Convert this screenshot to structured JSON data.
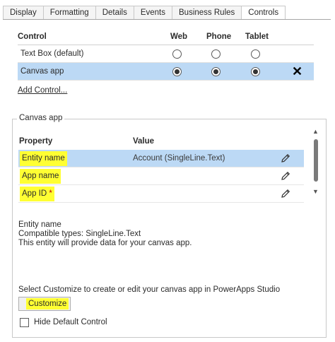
{
  "tabs": [
    {
      "label": "Display"
    },
    {
      "label": "Formatting"
    },
    {
      "label": "Details"
    },
    {
      "label": "Events"
    },
    {
      "label": "Business Rules"
    },
    {
      "label": "Controls"
    }
  ],
  "active_tab": "Controls",
  "controls": {
    "headers": {
      "control": "Control",
      "web": "Web",
      "phone": "Phone",
      "tablet": "Tablet"
    },
    "rows": [
      {
        "name": "Text Box (default)",
        "web": false,
        "phone": false,
        "tablet": false,
        "selected": false
      },
      {
        "name": "Canvas app",
        "web": true,
        "phone": true,
        "tablet": true,
        "selected": true
      }
    ],
    "add_link": "Add Control..."
  },
  "canvas_group": {
    "title": "Canvas app",
    "headers": {
      "property": "Property",
      "value": "Value"
    },
    "properties": [
      {
        "name": "Entity name",
        "value": "Account (SingleLine.Text)",
        "required": false,
        "selected": true
      },
      {
        "name": "App name",
        "value": "",
        "required": false,
        "selected": false
      },
      {
        "name": "App ID",
        "value": "",
        "required": true,
        "selected": false
      }
    ],
    "required_marker": "*",
    "description": {
      "title": "Entity name",
      "types": "Compatible types: SingleLine.Text",
      "text": "This entity will provide data for your canvas app."
    },
    "customize_text": "Select Customize to create or edit your canvas app in PowerApps Studio",
    "customize_button": "Customize",
    "hide_default_label": "Hide Default Control",
    "hide_default_checked": false
  },
  "icons": {
    "remove": "close-icon",
    "edit": "pencil-icon",
    "scroll_up": "triangle-up-icon",
    "scroll_down": "triangle-down-icon"
  },
  "colors": {
    "selected_row": "#bcd9f5",
    "highlight": "#ffff33",
    "required": "#c00000"
  }
}
